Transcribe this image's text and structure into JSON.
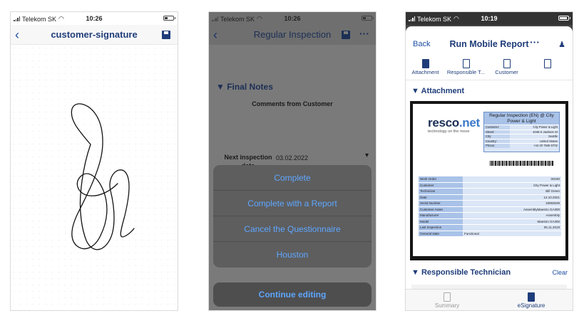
{
  "screen1": {
    "status": {
      "carrier": "Telekom SK",
      "time": "10:26"
    },
    "title": "customer-signature"
  },
  "screen2": {
    "status": {
      "carrier": "Telekom SK",
      "time": "10:26"
    },
    "title": "Regular Inspection",
    "section_title": "Final Notes",
    "comments_label": "Comments from Customer",
    "next_inspection_label": "Next inspection date",
    "next_inspection_value": "03.02.2022",
    "actions": [
      {
        "label": "Complete"
      },
      {
        "label": "Complete with a Report"
      },
      {
        "label": "Cancel the Questionnaire"
      },
      {
        "label": "Houston"
      }
    ],
    "cancel_label": "Continue editing"
  },
  "screen3": {
    "status": {
      "carrier": "Telekom SK",
      "time": "10:19"
    },
    "back_label": "Back",
    "title": "Run Mobile Report",
    "tabs": [
      {
        "label": "Attachment"
      },
      {
        "label": "Responsible T..."
      },
      {
        "label": "Customer"
      },
      {
        "label": ""
      }
    ],
    "section_attachment": "Attachment",
    "section_technician": "Responsible Technician",
    "clear_label": "Clear",
    "doc": {
      "logo_main": "resco",
      "logo_dot": ".net",
      "logo_tagline": "technology on the move",
      "header_title": "Regular Inspection (EN) @ City Power & Light",
      "header_rows": [
        {
          "k": "Customer:",
          "v": "City Power & Light"
        },
        {
          "k": "Street:",
          "v": "1048 S Jackson St"
        },
        {
          "k": "City:",
          "v": "Seattle"
        },
        {
          "k": "Country:",
          "v": "United States"
        },
        {
          "k": "Phone:",
          "v": "+44 20 7946 9702"
        }
      ],
      "rows": [
        {
          "k": "Work Order",
          "v": "00190"
        },
        {
          "k": "Customer",
          "v": "City Power & Light"
        },
        {
          "k": "Technician",
          "v": "Bill Green"
        },
        {
          "k": "Date",
          "v": "12.10.2021"
        },
        {
          "k": "Serial Number",
          "v": "18083639"
        },
        {
          "k": "Customer Asset",
          "v": "AssemblyMaestro GA300"
        },
        {
          "k": "Manufacturer",
          "v": "Assembly"
        },
        {
          "k": "Model",
          "v": "Maestro GA300"
        },
        {
          "k": "Last Inspection",
          "v": "05.11.2019"
        },
        {
          "k": "General state",
          "v": "Functional"
        }
      ]
    },
    "bottom_tabs": [
      {
        "label": "Summary"
      },
      {
        "label": "eSignature"
      }
    ]
  }
}
